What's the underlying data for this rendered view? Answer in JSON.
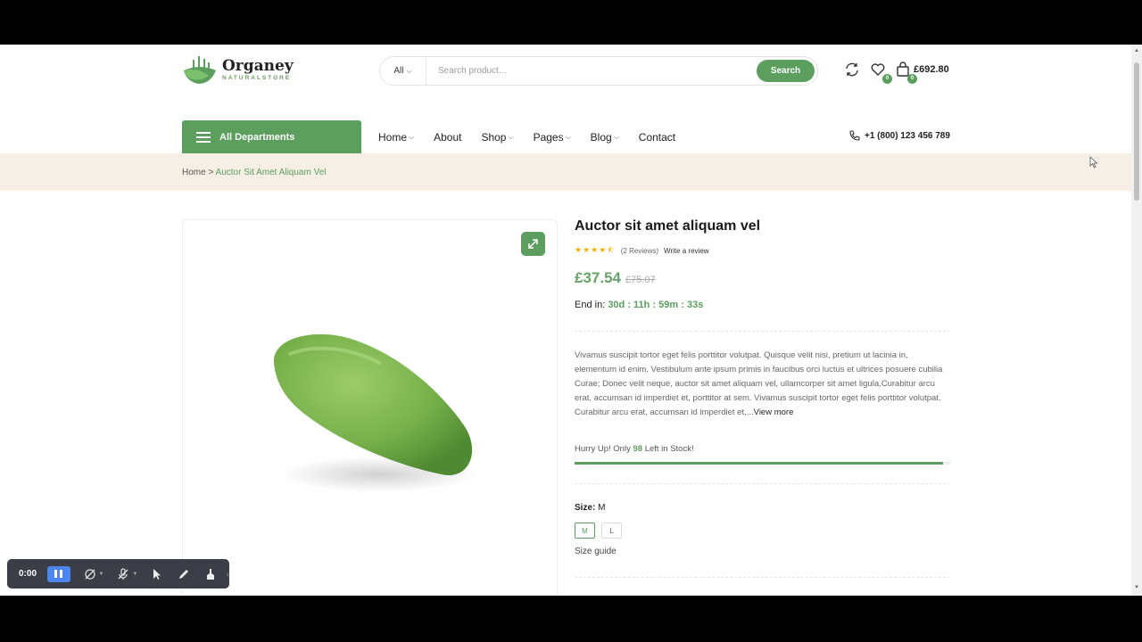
{
  "brand": {
    "name": "Organey",
    "tagline": "NATURALSTORE"
  },
  "search": {
    "category": "All",
    "placeholder": "Search product...",
    "button": "Search"
  },
  "header": {
    "compare_icon": "refresh-icon",
    "wishlist_count": "0",
    "cart_count": "0",
    "cart_total": "£692.80"
  },
  "nav": {
    "departments": "All Departments",
    "items": [
      {
        "label": "Home",
        "dropdown": true
      },
      {
        "label": "About",
        "dropdown": false
      },
      {
        "label": "Shop",
        "dropdown": true
      },
      {
        "label": "Pages",
        "dropdown": true
      },
      {
        "label": "Blog",
        "dropdown": true
      },
      {
        "label": "Contact",
        "dropdown": false
      }
    ],
    "phone": "+1 (800) 123 456 789"
  },
  "breadcrumb": {
    "home": "Home",
    "separator": ">",
    "current": "Auctor Sit Amet Aliquam Vel"
  },
  "product": {
    "title": "Auctor sit amet aliquam vel",
    "rating": 4.5,
    "reviews": "(2 Reviews)",
    "write_review": "Write a review",
    "price": "£37.54",
    "old_price": "£75.07",
    "end_in_label": "End in:",
    "countdown": "30d : 11h : 59m : 33s",
    "description": "Vivamus suscipit tortor eget felis porttitor volutpat. Quisque velit nisi, pretium ut lacinia in, elementum id enim. Vestibulum ante ipsum primis in faucibus orci luctus et ultrices posuere cubilia Curae; Donec velit neque, auctor sit amet aliquam vel, ullamcorper sit amet ligula.Curabitur arcu erat, accumsan id imperdiet et, porttitor at sem. Vivamus suscipit tortor eget felis porttitor volutpat. Curabitur arcu erat, accumsan id imperdiet et,...",
    "view_more": "View more",
    "stock_prefix": "Hurry Up! Only",
    "stock_count": "98",
    "stock_suffix": "Left in Stock!",
    "stock_fill_fraction": 0.98,
    "size_label": "Size:",
    "size_selected": "M",
    "sizes": [
      "M",
      "L"
    ],
    "size_guide": "Size guide"
  },
  "recorder": {
    "time": "0:00"
  },
  "colors": {
    "accent": "#5b9e5d",
    "breadcrumb_bg": "#f6efe6",
    "star": "#f4b400"
  }
}
